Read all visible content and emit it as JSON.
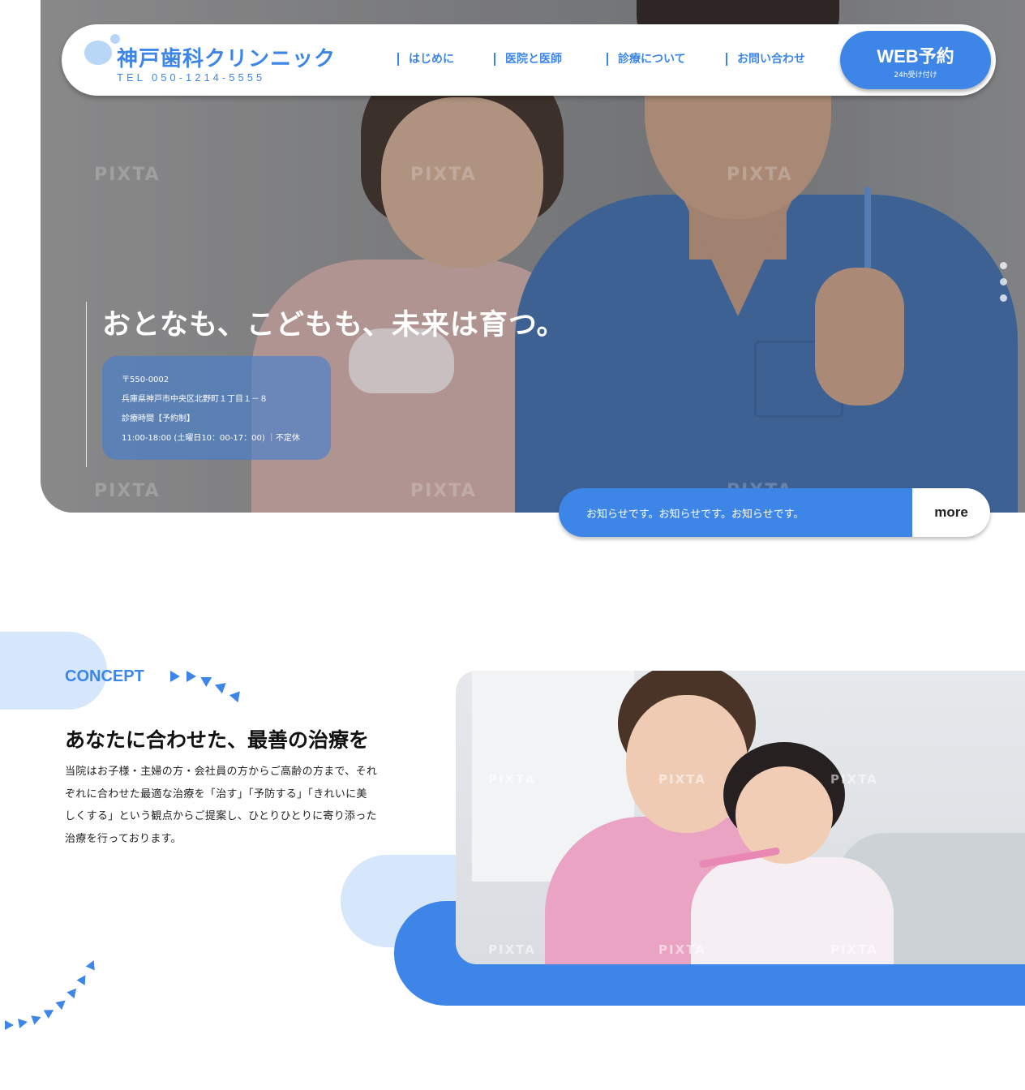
{
  "header": {
    "clinic_name": "神戸歯科クリンニック",
    "tel": "TEL 050-1214-5555",
    "nav": [
      "はじめに",
      "医院と医師",
      "診療について",
      "お問い合わせ"
    ],
    "web_button": {
      "label": "WEB予約",
      "sub": "24h受け付け"
    }
  },
  "hero": {
    "catch": "おとなも、こどもも、未来は育つ。",
    "info": {
      "postal": "〒550-0002",
      "address": "兵庫県神戸市中央区北野町１丁目１－８",
      "hours_label": "診療時間【予約制】",
      "hours": "11:00-18:00 (土曜日10：00-17：00) ｜不定休"
    },
    "watermark": "PIXTA"
  },
  "news": {
    "text": "お知らせです。お知らせです。お知らせです。",
    "more_label": "more"
  },
  "concept": {
    "label": "CONCEPT",
    "heading": "あなたに合わせた、最善の治療を",
    "body_lines": [
      "当院はお子様・主婦の方・会社員の方からご高齢の方まで、それ",
      "ぞれに合わせた最適な治療を「治す」「予防する」「きれいに美",
      "しくする」という観点からご提案し、ひとりひとりに寄り添った",
      "治療を行っております。"
    ]
  },
  "colors": {
    "accent": "#3d86e8",
    "accent_light": "#d6e6fb"
  }
}
